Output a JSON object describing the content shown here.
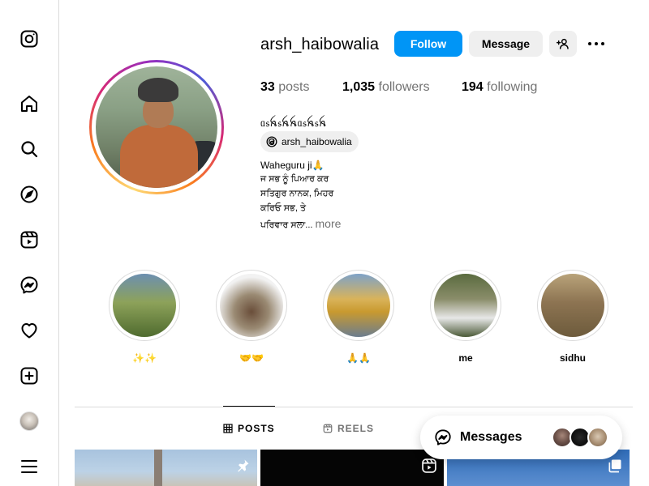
{
  "profile": {
    "username": "arsh_haibowalia",
    "follow_label": "Follow",
    "message_label": "Message",
    "stats": {
      "posts_count": "33",
      "posts_label": "posts",
      "followers_count": "1,035",
      "followers_label": "followers",
      "following_count": "194",
      "following_label": "following"
    },
    "display_name": "ᥲ᥉ꫝ᥉ꫝꫝᥲ᥉ꫝ᥉ꫝ",
    "threads_handle": "arsh_haibowalia",
    "bio_lines": [
      "Waheguru ji🙏",
      "ਜ ਸਭ ਨੂੰ ਪਿਆਰ ਕਰ",
      "ਸਤਿਗੁਰ ਨਾਨਕ, ਮਿਹਰ",
      "ਕਰਿਓ ਸਭ, ਤੇ",
      "ਪਰਿਵਾਰ ਸਲਾ..."
    ],
    "more_label": "more"
  },
  "highlights": [
    {
      "label": "✨✨"
    },
    {
      "label": "🤝🤝"
    },
    {
      "label": "🙏🙏"
    },
    {
      "label": "me"
    },
    {
      "label": "sidhu"
    }
  ],
  "tabs": {
    "posts": "POSTS",
    "reels": "REELS"
  },
  "messages": {
    "label": "Messages"
  },
  "icons": {
    "brand": "instagram-icon",
    "home": "home-icon",
    "search": "search-icon",
    "explore": "compass-icon",
    "reels": "reels-icon",
    "messenger": "messenger-icon",
    "notifications": "heart-icon",
    "create": "plus-square-icon",
    "menu": "hamburger-icon"
  },
  "colors": {
    "primary": "#0095f6",
    "secondary_bg": "#efefef",
    "muted_text": "#737373",
    "border": "#dbdbdb"
  }
}
